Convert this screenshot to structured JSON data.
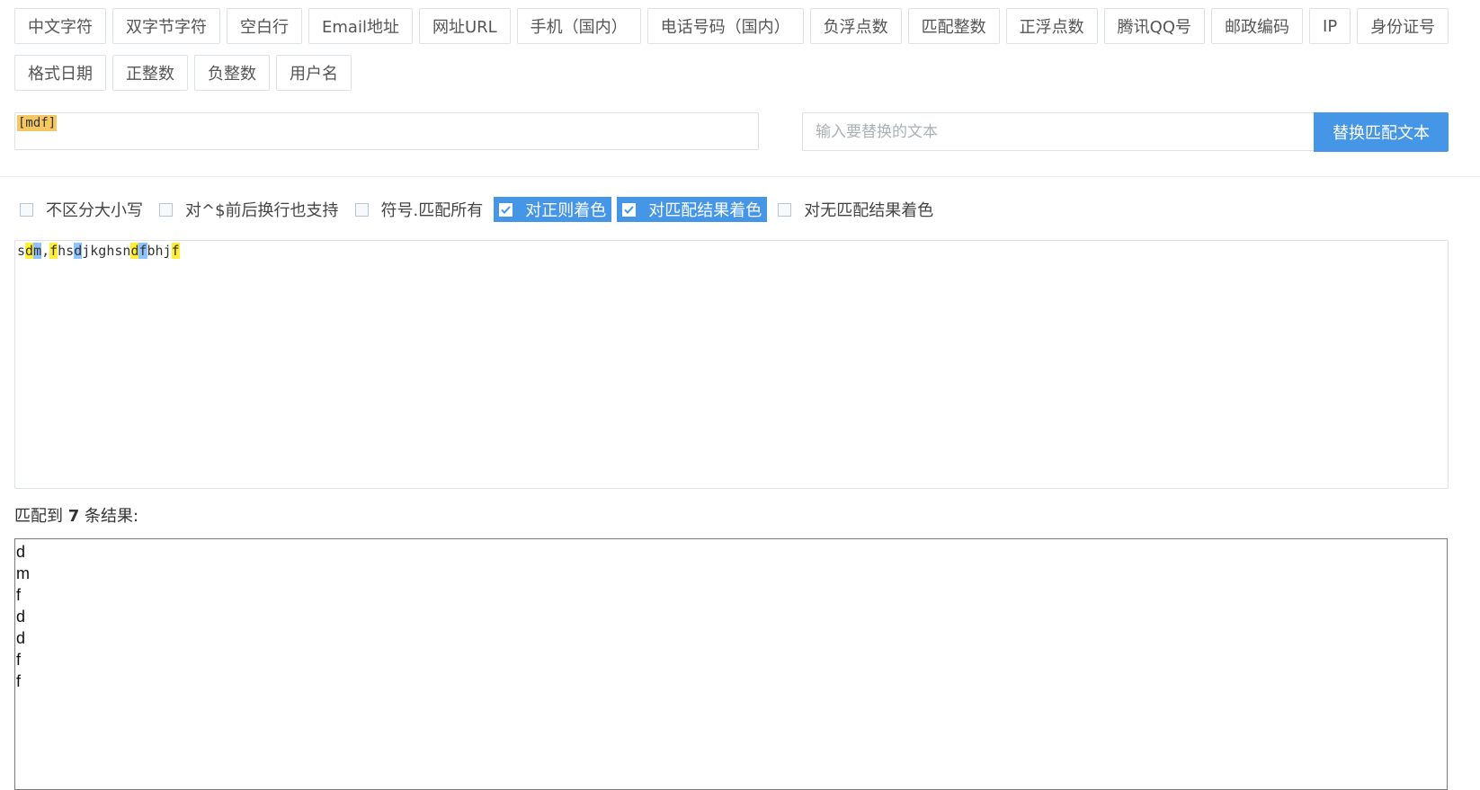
{
  "presets": [
    "中文字符",
    "双字节字符",
    "空白行",
    "Email地址",
    "网址URL",
    "手机（国内）",
    "电话号码（国内）",
    "负浮点数",
    "匹配整数",
    "正浮点数",
    "腾讯QQ号",
    "邮政编码",
    "IP",
    "身份证号",
    "格式日期",
    "正整数",
    "负整数",
    "用户名"
  ],
  "regex": {
    "value": "[mdf]"
  },
  "replace": {
    "placeholder": "输入要替换的文本",
    "button_label": "替换匹配文本"
  },
  "options": [
    {
      "label": "不区分大小写",
      "checked": false
    },
    {
      "label": "对^$前后换行也支持",
      "checked": false
    },
    {
      "label": "符号.匹配所有",
      "checked": false
    },
    {
      "label": "对正则着色",
      "checked": true
    },
    {
      "label": "对匹配结果着色",
      "checked": true
    },
    {
      "label": "对无匹配结果着色",
      "checked": false
    }
  ],
  "source_text": {
    "segments": [
      {
        "text": "s",
        "hl": ""
      },
      {
        "text": "d",
        "hl": "y"
      },
      {
        "text": "m",
        "hl": "b"
      },
      {
        "text": ",",
        "hl": ""
      },
      {
        "text": "f",
        "hl": "y"
      },
      {
        "text": "hs",
        "hl": ""
      },
      {
        "text": "d",
        "hl": "b"
      },
      {
        "text": "jkghsn",
        "hl": ""
      },
      {
        "text": "d",
        "hl": "y"
      },
      {
        "text": "f",
        "hl": "b"
      },
      {
        "text": "bhj",
        "hl": ""
      },
      {
        "text": "f",
        "hl": "y"
      }
    ]
  },
  "result": {
    "prefix": "匹配到 ",
    "count": "7",
    "suffix": " 条结果:"
  },
  "matches": [
    "d",
    "m",
    "f",
    "d",
    "d",
    "f",
    "f"
  ],
  "colors": {
    "accent": "#4596e6",
    "highlight_yellow": "#ffee33",
    "highlight_blue": "#8ec3ff",
    "regex_highlight": "#f5c760"
  }
}
